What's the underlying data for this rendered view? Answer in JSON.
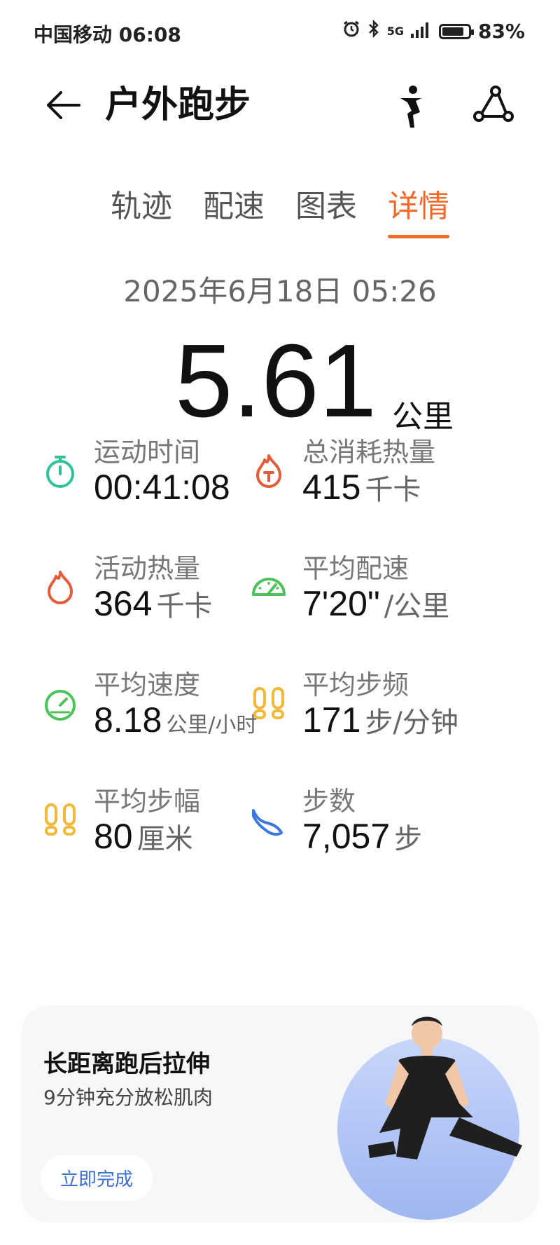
{
  "status": {
    "carrier_time": "中国移动 06:08",
    "network": "5G",
    "battery_pct": "83%",
    "battery_level": 0.83
  },
  "header": {
    "title": "户外跑步"
  },
  "tabs": [
    {
      "label": "轨迹"
    },
    {
      "label": "配速"
    },
    {
      "label": "图表"
    },
    {
      "label": "详情",
      "active": true
    }
  ],
  "summary": {
    "datetime": "2025年6月18日 05:26",
    "distance": "5.61",
    "distance_unit": "公里"
  },
  "stats": [
    {
      "label": "运动时间",
      "value": "00:41:08",
      "unit": "",
      "icon": "stopwatch-icon",
      "color": "#2FC29A"
    },
    {
      "label": "总消耗热量",
      "value": "415",
      "unit": "千卡",
      "icon": "fire-t-icon",
      "color": "#E45C3A"
    },
    {
      "label": "活动热量",
      "value": "364",
      "unit": "千卡",
      "icon": "flame-icon",
      "color": "#E45C3A"
    },
    {
      "label": "平均配速",
      "value": "7'20\"",
      "unit": "/公里",
      "icon": "speedometer-icon",
      "color": "#4CC25A"
    },
    {
      "label": "平均速度",
      "value": "8.18",
      "unit": "公里/小时",
      "icon": "speed-gauge-icon",
      "color": "#4CC25A"
    },
    {
      "label": "平均步频",
      "value": "171",
      "unit": "步/分钟",
      "icon": "footprints-icon",
      "color": "#F0B93A"
    },
    {
      "label": "平均步幅",
      "value": "80",
      "unit": "厘米",
      "icon": "footprints-icon",
      "color": "#F0B93A"
    },
    {
      "label": "步数",
      "value": "7,057",
      "unit": "步",
      "icon": "shoe-icon",
      "color": "#3A78E0"
    }
  ],
  "card": {
    "title": "长距离跑后拉伸",
    "subtitle": "9分钟充分放松肌肉",
    "button": "立即完成"
  }
}
